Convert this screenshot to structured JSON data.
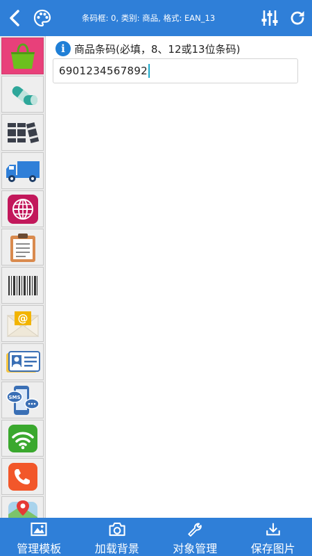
{
  "header": {
    "title": "条码框: 0, 类别: 商品, 格式: EAN_13",
    "icons": [
      "back-icon",
      "palette-icon",
      "sliders-icon",
      "refresh-icon"
    ]
  },
  "sidebar": {
    "categories": [
      {
        "name": "shopping-bag",
        "icon": "shopping-bag-icon",
        "active": true
      },
      {
        "name": "pill",
        "icon": "pill-icon"
      },
      {
        "name": "books",
        "icon": "books-icon"
      },
      {
        "name": "truck",
        "icon": "truck-icon"
      },
      {
        "name": "globe",
        "icon": "globe-icon"
      },
      {
        "name": "clipboard",
        "icon": "clipboard-icon"
      },
      {
        "name": "barcode",
        "icon": "barcode-icon"
      },
      {
        "name": "email",
        "icon": "email-icon"
      },
      {
        "name": "id-card",
        "icon": "id-card-icon"
      },
      {
        "name": "sms",
        "icon": "sms-icon"
      },
      {
        "name": "wifi",
        "icon": "wifi-icon"
      },
      {
        "name": "phone",
        "icon": "phone-icon"
      },
      {
        "name": "map",
        "icon": "map-icon"
      }
    ]
  },
  "form": {
    "label": "商品条码(必填，8、12或13位条码)",
    "value": "6901234567892"
  },
  "toolbar": {
    "buttons": [
      {
        "label": "管理模板",
        "icon": "template-icon"
      },
      {
        "label": "加载背景",
        "icon": "camera-icon"
      },
      {
        "label": "对象管理",
        "icon": "wrench-icon"
      },
      {
        "label": "保存图片",
        "icon": "download-icon"
      }
    ]
  },
  "colors": {
    "primary": "#2f7fd8",
    "active_category": "#e8407a",
    "info": "#1f7fd6",
    "caret": "#1aa7c7"
  }
}
